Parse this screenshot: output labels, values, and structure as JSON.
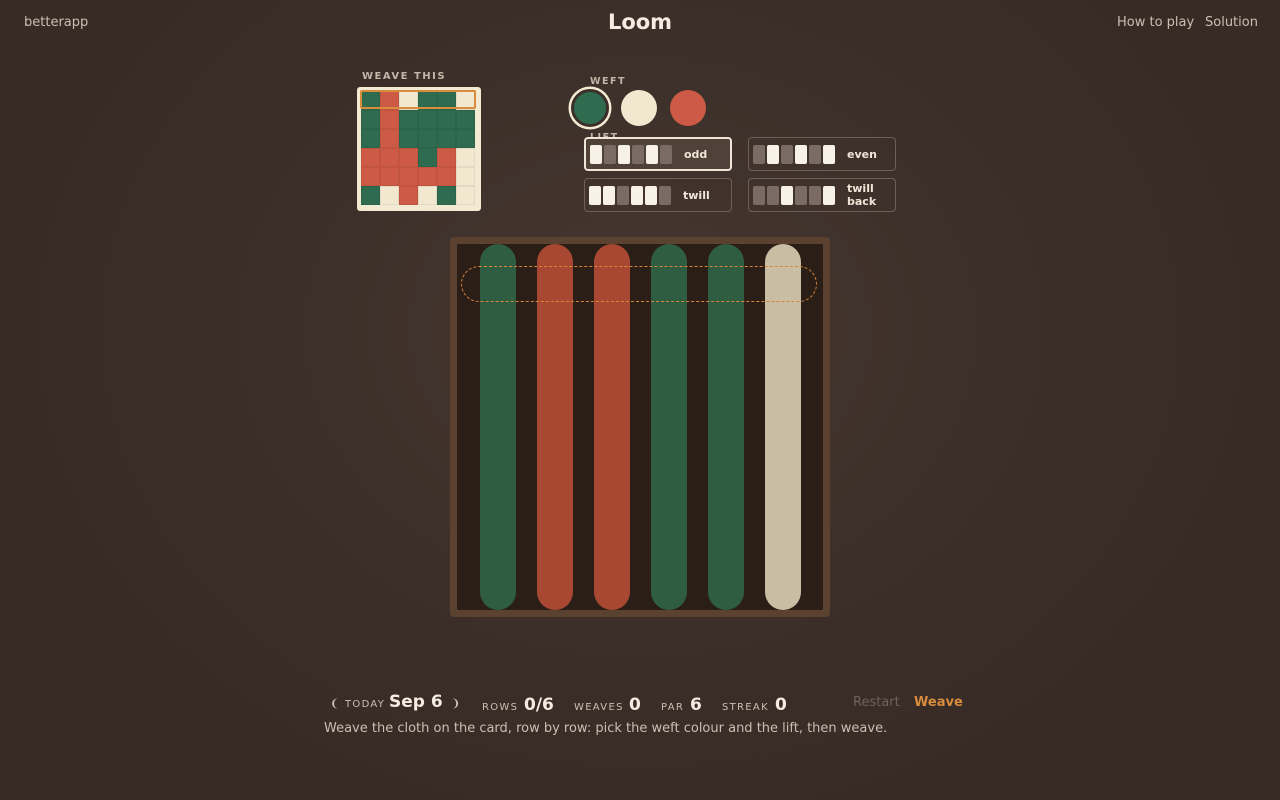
{
  "header": {
    "brand": "betterapp",
    "title": "Loom",
    "how_to_play": "How to play",
    "solution": "Solution"
  },
  "target": {
    "label": "WEAVE THIS",
    "highlighted_row": 0,
    "rows": [
      [
        "green",
        "red",
        "cream",
        "green",
        "green",
        "cream"
      ],
      [
        "green",
        "red",
        "green",
        "green",
        "green",
        "green"
      ],
      [
        "green",
        "red",
        "green",
        "green",
        "green",
        "green"
      ],
      [
        "red",
        "red",
        "red",
        "green",
        "red",
        "cream"
      ],
      [
        "red",
        "red",
        "red",
        "red",
        "red",
        "cream"
      ],
      [
        "green",
        "cream",
        "red",
        "cream",
        "green",
        "cream"
      ]
    ]
  },
  "colors": {
    "green": "#2f6b4f",
    "red": "#cc5a44",
    "cream": "#f1e8cf",
    "accent": "#d88c3e"
  },
  "weft": {
    "label": "WEFT",
    "selected": "green",
    "options": [
      {
        "name": "green",
        "color": "#2f6b4f"
      },
      {
        "name": "cream",
        "color": "#f1e8cf"
      },
      {
        "name": "red",
        "color": "#cc5a44"
      }
    ]
  },
  "lift": {
    "label": "LIFT",
    "selected": "odd",
    "options": [
      {
        "name": "odd",
        "pattern": [
          1,
          0,
          1,
          0,
          1,
          0
        ]
      },
      {
        "name": "even",
        "pattern": [
          0,
          1,
          0,
          1,
          0,
          1
        ]
      },
      {
        "name": "twill",
        "pattern": [
          1,
          1,
          0,
          1,
          1,
          0
        ]
      },
      {
        "name": "twill back",
        "pattern": [
          0,
          0,
          1,
          0,
          0,
          1
        ]
      }
    ]
  },
  "loom": {
    "warps": [
      {
        "color": "#2f5d42"
      },
      {
        "color": "#a84833"
      },
      {
        "color": "#a84833"
      },
      {
        "color": "#2f5d42"
      },
      {
        "color": "#2f5d42"
      },
      {
        "color": "#c9bda4"
      }
    ]
  },
  "footer": {
    "today_label": "TODAY",
    "date": "Sep 6",
    "prev_glyph": "❨",
    "next_glyph": "❩",
    "rows_label": "ROWS",
    "rows_value": "0/6",
    "weaves_label": "WEAVES",
    "weaves_value": "0",
    "par_label": "PAR",
    "par_value": "6",
    "streak_label": "STREAK",
    "streak_value": "0",
    "restart": "Restart",
    "weave": "Weave",
    "hint": "Weave the cloth on the card, row by row: pick the weft colour and the lift, then weave."
  }
}
